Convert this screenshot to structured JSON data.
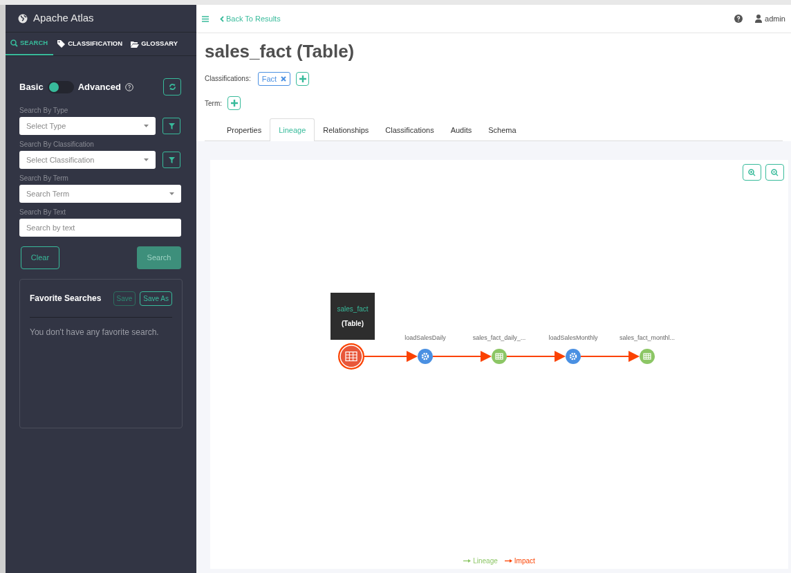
{
  "app": {
    "title": "Apache Atlas"
  },
  "sidebar_tabs": [
    {
      "label": "SEARCH",
      "selected": true
    },
    {
      "label": "CLASSIFICATION",
      "selected": false
    },
    {
      "label": "GLOSSARY",
      "selected": false
    }
  ],
  "mode": {
    "basic_label": "Basic",
    "advanced_label": "Advanced",
    "advanced": false
  },
  "filters": [
    {
      "label": "Search By Type",
      "placeholder": "Select Type",
      "kind": "select",
      "filter_button": true
    },
    {
      "label": "Search By Classification",
      "placeholder": "Select Classification",
      "kind": "select",
      "filter_button": true
    },
    {
      "label": "Search By Term",
      "placeholder": "Search Term",
      "kind": "select",
      "filter_button": false
    },
    {
      "label": "Search By Text",
      "placeholder": "Search by text",
      "kind": "text",
      "filter_button": false
    }
  ],
  "actions": {
    "clear": "Clear",
    "search": "Search"
  },
  "favorites": {
    "title": "Favorite Searches",
    "save": "Save",
    "save_as": "Save As",
    "empty": "You don't have any favorite search."
  },
  "topbar": {
    "back": "Back To Results",
    "user": "admin"
  },
  "entity": {
    "title": "sales_fact (Table)",
    "classifications_label": "Classifications:",
    "classifications": [
      "Fact"
    ],
    "term_label": "Term:"
  },
  "tabs": [
    {
      "label": "Properties",
      "selected": false
    },
    {
      "label": "Lineage",
      "selected": true
    },
    {
      "label": "Relationships",
      "selected": false
    },
    {
      "label": "Classifications",
      "selected": false
    },
    {
      "label": "Audits",
      "selected": false
    },
    {
      "label": "Schema",
      "selected": false
    }
  ],
  "lineage": {
    "tooltip": {
      "name": "sales_fact",
      "type": "(Table)"
    },
    "nodes": [
      {
        "kind": "table",
        "current": true
      },
      {
        "kind": "process",
        "current": false,
        "label": "loadSalesDaily"
      },
      {
        "kind": "table",
        "current": false,
        "label": "sales_fact_daily_..."
      },
      {
        "kind": "process",
        "current": false,
        "label": "loadSalesMonthly"
      },
      {
        "kind": "table",
        "current": false,
        "label": "sales_fact_monthl..."
      }
    ],
    "legend": [
      {
        "label": "Lineage",
        "color": "#8cc665"
      },
      {
        "label": "Impact",
        "color": "#fb4200"
      }
    ]
  }
}
